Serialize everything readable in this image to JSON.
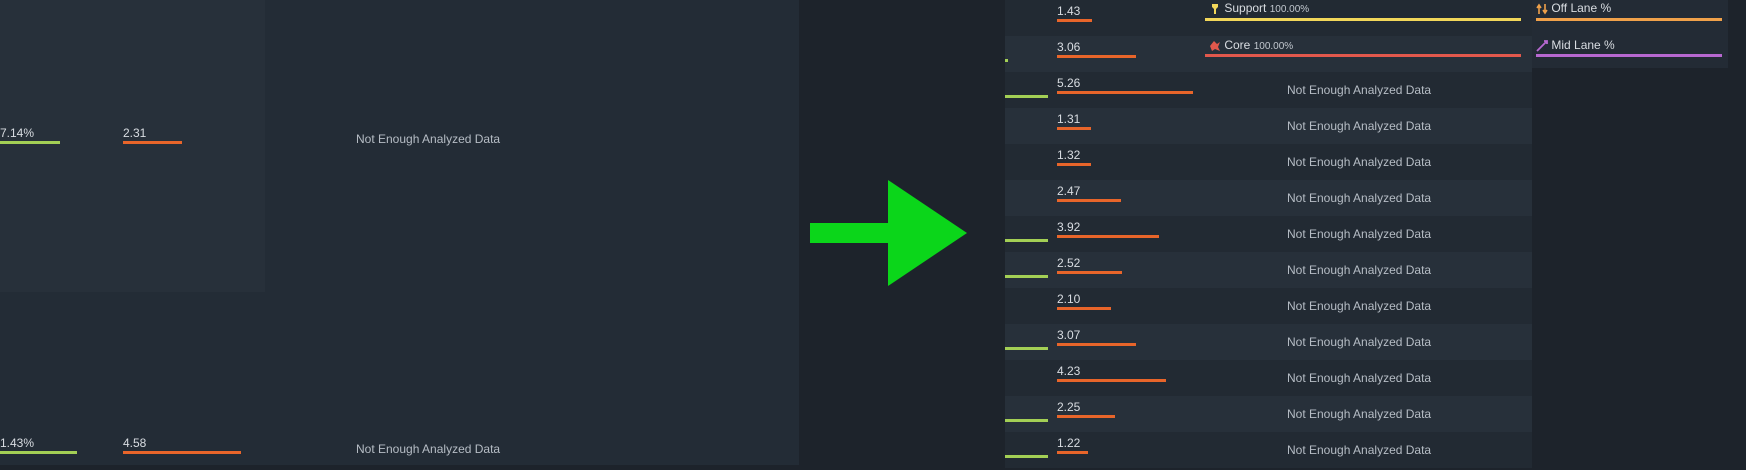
{
  "left": {
    "row1": {
      "winrate": "7.14%",
      "kda": "2.31",
      "analysis": "Not Enough Analyzed Data"
    },
    "row2": {
      "winrate": "1.43%",
      "kda": "4.58",
      "analysis": "Not Enough Analyzed Data"
    }
  },
  "arrow": {
    "color": "#0bd61a"
  },
  "right": {
    "rows": [
      {
        "kda": "1.43",
        "bar": 0.26,
        "analysis": ""
      },
      {
        "kda": "3.06",
        "bar": 0.58,
        "analysis": ""
      },
      {
        "kda": "5.26",
        "bar": 1.0,
        "analysis": "Not Enough Analyzed Data"
      },
      {
        "kda": "1.31",
        "bar": 0.25,
        "analysis": "Not Enough Analyzed Data"
      },
      {
        "kda": "1.32",
        "bar": 0.25,
        "analysis": "Not Enough Analyzed Data"
      },
      {
        "kda": "2.47",
        "bar": 0.47,
        "analysis": "Not Enough Analyzed Data"
      },
      {
        "kda": "3.92",
        "bar": 0.75,
        "analysis": "Not Enough Analyzed Data"
      },
      {
        "kda": "2.52",
        "bar": 0.48,
        "analysis": "Not Enough Analyzed Data"
      },
      {
        "kda": "2.10",
        "bar": 0.4,
        "analysis": "Not Enough Analyzed Data"
      },
      {
        "kda": "3.07",
        "bar": 0.58,
        "analysis": "Not Enough Analyzed Data"
      },
      {
        "kda": "4.23",
        "bar": 0.8,
        "analysis": "Not Enough Analyzed Data"
      },
      {
        "kda": "2.25",
        "bar": 0.43,
        "analysis": "Not Enough Analyzed Data"
      },
      {
        "kda": "1.22",
        "bar": 0.23,
        "analysis": "Not Enough Analyzed Data"
      }
    ],
    "roles": {
      "support": {
        "label": "Support",
        "pct": "100.00%",
        "color": "#f2d75a"
      },
      "core": {
        "label": "Core",
        "pct": "100.00%",
        "color": "#e2584c"
      },
      "offlane": {
        "label": "Off Lane %",
        "color": "#f0a14a"
      },
      "midlane": {
        "label": "Mid Lane %",
        "color": "#b768d0"
      }
    }
  }
}
